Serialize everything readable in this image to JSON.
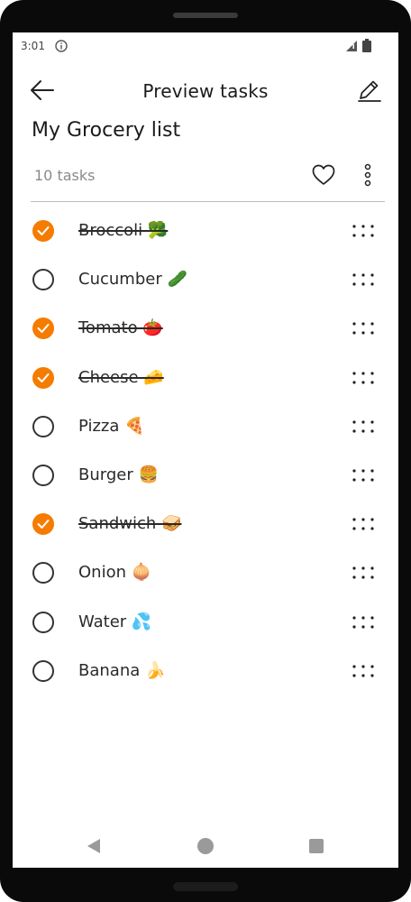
{
  "status_bar": {
    "time": "3:01"
  },
  "app_bar": {
    "title": "Preview tasks"
  },
  "list": {
    "title": "My Grocery list",
    "task_count": "10 tasks"
  },
  "colors": {
    "accent": "#f57c00"
  },
  "icons": {
    "back": "arrow-left-icon",
    "edit": "pencil-icon",
    "favorite": "heart-outline-icon",
    "more": "more-vertical-icon",
    "drag": "drag-handle-icon"
  },
  "tasks": [
    {
      "label": "Broccoli 🥦",
      "done": true
    },
    {
      "label": "Cucumber 🥒",
      "done": false
    },
    {
      "label": "Tomato 🍅",
      "done": true
    },
    {
      "label": "Cheese 🧀",
      "done": true
    },
    {
      "label": "Pizza 🍕",
      "done": false
    },
    {
      "label": "Burger 🍔",
      "done": false
    },
    {
      "label": "Sandwich 🥪",
      "done": true
    },
    {
      "label": "Onion 🧅",
      "done": false
    },
    {
      "label": "Water 💦",
      "done": false
    },
    {
      "label": "Banana 🍌",
      "done": false
    }
  ]
}
